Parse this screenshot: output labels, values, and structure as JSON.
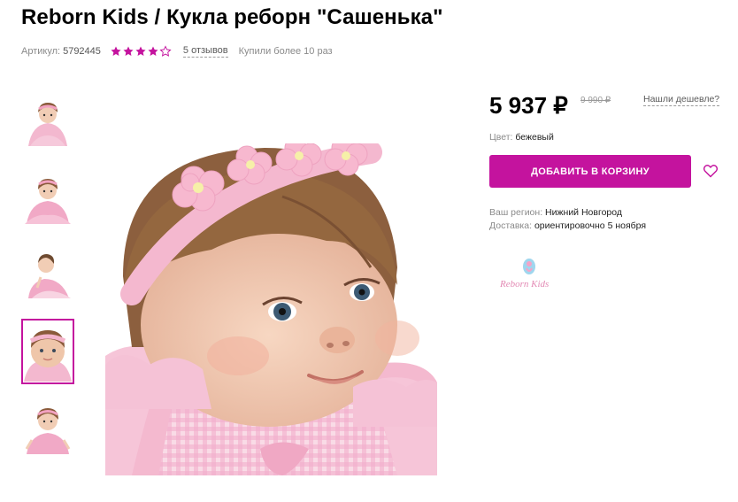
{
  "product": {
    "title": "Reborn Kids / Кукла реборн \"Сашенька\"",
    "sku_label": "Артикул:",
    "sku_value": "5792445",
    "rating": 4,
    "rating_max": 5,
    "reviews_label": "5 отзывов",
    "bought_label": "Купили более 10 раз"
  },
  "price": {
    "current": "5 937 ₽",
    "old": "9 990 ₽",
    "cheaper_link": "Нашли дешевле?"
  },
  "color": {
    "label": "Цвет:",
    "value": "бежевый"
  },
  "cart": {
    "button_label": "ДОБАВИТЬ В КОРЗИНУ"
  },
  "region": {
    "label": "Ваш регион:",
    "value": "Нижний Новгород"
  },
  "delivery": {
    "label": "Доставка:",
    "value": "ориентировочно 5 ноября"
  },
  "brand": {
    "logo_text": "Reborn Kids"
  },
  "colors": {
    "accent": "#c4139e",
    "star_empty": "#c4139e"
  },
  "gallery": {
    "selected_index": 3,
    "count": 5
  }
}
